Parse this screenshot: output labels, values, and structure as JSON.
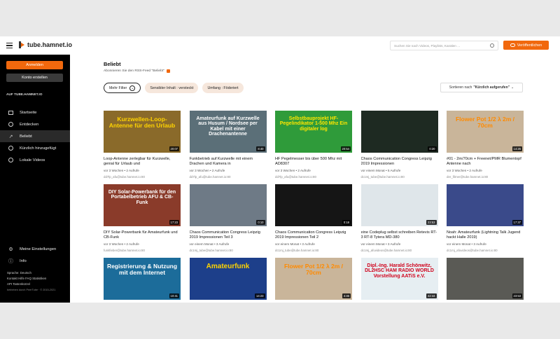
{
  "header": {
    "logo_text": "tube.hamnet.io",
    "search_placeholder": "Suchen Sie nach Videos, Playlists, Kanälen …",
    "publish_label": "Veröffentlichen"
  },
  "sidebar": {
    "login_label": "Anmelden",
    "create_account_label": "Konto erstellen",
    "heading": "AUF TUBE.HAMNET.IO",
    "items": [
      {
        "label": "Startseite",
        "icon": "home-icon",
        "active": false
      },
      {
        "label": "Entdecken",
        "icon": "discover-icon",
        "active": false
      },
      {
        "label": "Beliebt",
        "icon": "trending-icon",
        "active": true
      },
      {
        "label": "Kürzlich hinzugefügt",
        "icon": "recent-icon",
        "active": false
      },
      {
        "label": "Lokale Videos",
        "icon": "video-icon",
        "active": false
      }
    ],
    "bottom_items": [
      {
        "label": "Meine Einstellungen",
        "icon": "gear-icon"
      },
      {
        "label": "Info",
        "icon": "info-icon"
      }
    ],
    "language": "Sprache: Deutsch",
    "links_line1": "Kontakt  Hilfe  FAQ  Statistiken",
    "links_line2": "API  Tastenkürzel",
    "powered": "betrieben durch PeerTube · © 2015-2021"
  },
  "main": {
    "title": "Beliebt",
    "rss": "Abonnieren Sie den RSS-Feed \"Beliebt\"",
    "filter_more": "Mehr Filter",
    "filter_sensitive": "Sensibler Inhalt : versteckt",
    "filter_scope": "Umfang : Föderiert",
    "sort_prefix": "Sortieren nach",
    "sort_value": "\"Kürzlich aufgerufen\""
  },
  "videos": [
    {
      "title": "Loop-Antenne zerlegbar für Kurzwelle, genial für Urlaub und",
      "meta": "vor 3 Wochen • 2 Aufrufe",
      "channel": "dd7lp_afu@tube.hamnet.io:80",
      "duration": "20:07",
      "thumb_text": "Kurzwellen-Loop-Antenne für den Urlaub",
      "bg": "#8a6a2a",
      "fg": "#ffd400"
    },
    {
      "title": "Funkbetrieb auf Kurzwelle mit einem Drachen und Kamera in",
      "meta": "vor 3 Wochen • 2 Aufrufe",
      "channel": "dd7lp_afu@tube.hamnet.io:80",
      "duration": "8:40",
      "thumb_text": "Amateurfunk auf Kurzwelle aus Husum / Nordsee per Kabel mit einer Drachenantenne",
      "bg": "#5b6f78",
      "fg": "#ffffff"
    },
    {
      "title": "HF Pegelmesser bis über 500 Mhz mit AD8307",
      "meta": "vor 3 Wochen • 2 Aufrufe",
      "channel": "dd7lp_afu@tube.hamnet.io:80",
      "duration": "20:54",
      "thumb_text": "Selbstbauprojekt HF-Pegelindikator 1-500 Mhz Ein digitaler log",
      "bg": "#2f9b3a",
      "fg": "#ffe600"
    },
    {
      "title": "Chaos Communication Congress Leipzig 2019 Impressionen",
      "meta": "vor einem Monat • 5 Aufrufe",
      "channel": "dc1mj_tube@tube.hamnet.io:80",
      "duration": "0:20",
      "thumb_text": "",
      "bg": "#1e2a22",
      "fg": "#ffffff"
    },
    {
      "title": "#01 - 2m/70cm + Freenet/PMR Blumentopf Antenne nach",
      "meta": "vor 3 Wochen • 2 Aufrufe",
      "channel": "der_filmer@tube.hamnet.io:80",
      "duration": "14:26",
      "thumb_text": "Flower Pot 1/2 λ 2m / 70cm",
      "bg": "#c9b59a",
      "fg": "#ff8a00"
    },
    {
      "title": "DIY Solar-Powerbank für Amateurfunk und CB-Funk",
      "meta": "vor 3 Wochen • 2 Aufrufe",
      "channel": "funkfieber@tube.hamnet.io:80",
      "duration": "17:23",
      "thumb_text": "DIY Solar-Powerbank für den Portabelbetrieb AFU & CB-Funk",
      "bg": "#8a3b2a",
      "fg": "#ffffff"
    },
    {
      "title": "Chaos Communication Congress Leipzig 2019 Impressionen Teil 3",
      "meta": "vor einem Monat • 3 Aufrufe",
      "channel": "dc1mj_tube@tube.hamnet.io:80",
      "duration": "0:10",
      "thumb_text": "",
      "bg": "#6e7a86",
      "fg": "#ffffff"
    },
    {
      "title": "Chaos Communication Congress Leipzig 2019 Impressionen Teil 2",
      "meta": "vor einem Monat • 3 Aufrufe",
      "channel": "dc1mj_tube@tube.hamnet.io:80",
      "duration": "0:18",
      "thumb_text": "",
      "bg": "#151515",
      "fg": "#ffffff"
    },
    {
      "title": "eine Codeplug selbst schreiben Retevis RT-3 RT-8 Tytera MD-380",
      "meta": "vor einem Monat • 3 Aufrufe",
      "channel": "dc1mj_afuvideos@tube.hamnet.io:80",
      "duration": "23:53",
      "thumb_text": "",
      "bg": "#dfe6ea",
      "fg": "#333333"
    },
    {
      "title": "Noah: Amateurfunk (Lightning Talk Jugend hackt Halle 2019)",
      "meta": "vor einem Monat • 3 Aufrufe",
      "channel": "dc1mj_afuvideos@tube.hamnet.io:80",
      "duration": "17:37",
      "thumb_text": "",
      "bg": "#3a4a8a",
      "fg": "#ffffff"
    },
    {
      "title": "",
      "meta": "",
      "channel": "",
      "duration": "10:41",
      "thumb_text": "Registrierung & Nutzung mit dem Internet",
      "bg": "#1c6c9a",
      "fg": "#ffffff"
    },
    {
      "title": "",
      "meta": "",
      "channel": "",
      "duration": "14:23",
      "thumb_text": "Amateurfunk",
      "bg": "#1d3f8a",
      "fg": "#ffd400"
    },
    {
      "title": "",
      "meta": "",
      "channel": "",
      "duration": "4:46",
      "thumb_text": "Flower Pot 1/2 λ 2m / 70cm",
      "bg": "#c9b59a",
      "fg": "#ff8a00"
    },
    {
      "title": "",
      "meta": "",
      "channel": "",
      "duration": "42:44",
      "thumb_text": "Dipl.-Ing. Harald Schönwitz, DL2HSC HAM RADIO WORLD Vorstellung AATiS e.V.",
      "bg": "#e6eef2",
      "fg": "#d0021b"
    },
    {
      "title": "",
      "meta": "",
      "channel": "",
      "duration": "23:53",
      "thumb_text": "",
      "bg": "#5a5a55",
      "fg": "#ffffff"
    }
  ]
}
